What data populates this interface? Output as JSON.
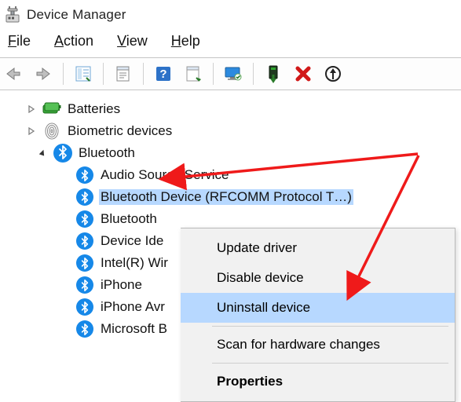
{
  "window": {
    "title": "Device Manager"
  },
  "menubar": {
    "file": "File",
    "action": "Action",
    "view": "View",
    "help": "Help"
  },
  "toolbar": {
    "back": "Back",
    "forward": "Forward",
    "show_hidden": "Show hidden devices",
    "properties": "Properties",
    "help": "Help",
    "update": "Update driver",
    "monitor": "Display device",
    "enable": "Enable device",
    "remove": "Uninstall device",
    "scan": "Scan for hardware changes"
  },
  "tree": {
    "batteries": "Batteries",
    "biometric": "Biometric devices",
    "bluetooth": "Bluetooth",
    "bt_children": {
      "audio_source": "Audio Source Service",
      "selected_device": "Bluetooth Device (RFCOMM Protocol T…)",
      "bt3": "Bluetooth",
      "device_ident": "Device Idе",
      "intel_wireless": "Intel(R) Wir",
      "iphone": "iPhone",
      "iphone_avr": "iPhone Avr",
      "microsoft_bt": "Microsoft B"
    }
  },
  "context_menu": {
    "update": "Update driver",
    "disable": "Disable device",
    "uninstall": "Uninstall device",
    "scan": "Scan for hardware changes",
    "properties": "Properties"
  }
}
